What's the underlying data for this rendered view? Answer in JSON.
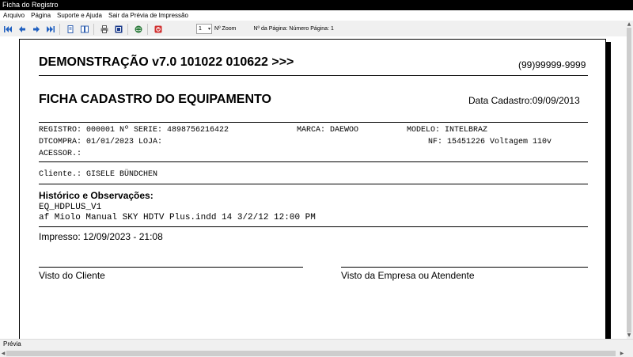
{
  "window": {
    "title": "Ficha do Registro"
  },
  "menu": {
    "items": [
      "Arquivo",
      "Página",
      "Suporte e Ajuda",
      "Sair da Prévia de Impressão"
    ]
  },
  "toolbar": {
    "zoom_value": "1",
    "zoom_label": "Nº Zoom",
    "page_label": "Nº da Página: Número Página: 1"
  },
  "report": {
    "company": "DEMONSTRAÇÃO v7.0 101022 010622 >>>",
    "phone": "(99)99999-9999",
    "title": "FICHA CADASTRO DO EQUIPAMENTO",
    "date_cadastro": "Data Cadastro:09/09/2013",
    "line1_left": "REGISTRO: 000001 Nº SERIE: 4898756216422",
    "line1_marca": "MARCA: DAEWOO",
    "line1_modelo": "MODELO: INTELBRAZ",
    "line2_left": "DTCOMPRA: 01/01/2023 LOJA:",
    "line2_right": "NF: 15451226 Voltagem 110v",
    "line3": "ACESSOR.:",
    "cliente": "Cliente.: GISELE BÜNDCHEN",
    "hist_title": "Histórico e Observações:",
    "hist_line1": "EQ_HDPLUS_V1",
    "hist_line2": "af Miolo Manual SKY HDTV Plus.indd 14 3/2/12 12:00 PM",
    "impresso": "Impresso: 12/09/2023 - 21:08",
    "visto_cliente": "Visto do Cliente",
    "visto_empresa": "Visto da Empresa ou Atendente"
  },
  "status": {
    "text": "Prévia"
  }
}
